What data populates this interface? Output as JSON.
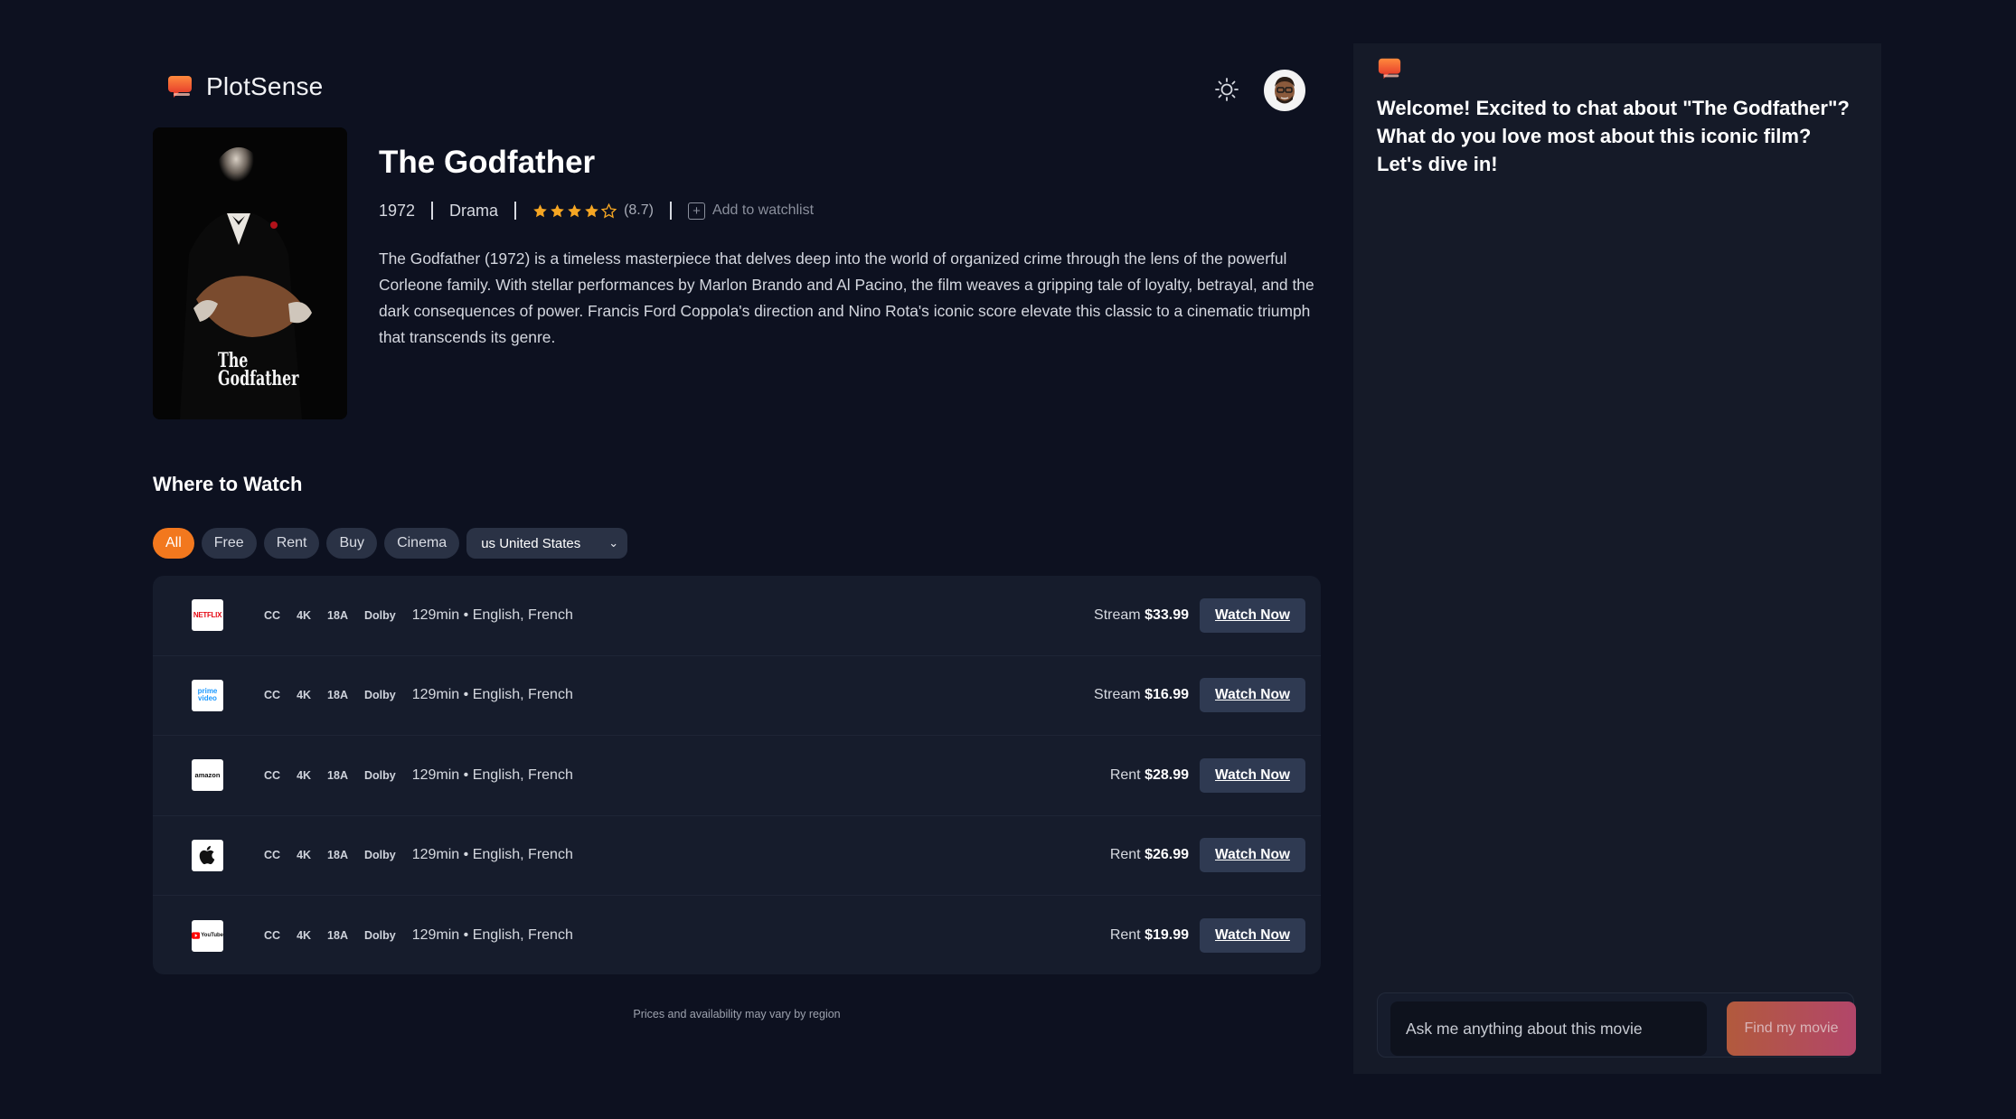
{
  "header": {
    "brand_name": "PlotSense",
    "brand_icon": "chat-bubble-logo-icon",
    "theme_icon": "sun-icon",
    "avatar_icon": "user-avatar"
  },
  "movie": {
    "title": "The Godfather",
    "year": "1972",
    "genre": "Drama",
    "rating_stars": 4.5,
    "rating_text": "(8.7)",
    "watchlist_label": "Add to watchlist",
    "description": "The Godfather (1972) is a timeless masterpiece that delves deep into the world of organized crime through the lens of the powerful Corleone family. With stellar performances by Marlon Brando and Al Pacino, the film weaves a gripping tale of loyalty, betrayal, and the dark consequences of power. Francis Ford Coppola's direction and Nino Rota's iconic score elevate this classic to a cinematic triumph that transcends its genre.",
    "poster_title_line1": "The",
    "poster_title_line2": "Godfather"
  },
  "where_to_watch": {
    "title": "Where to Watch",
    "filters": [
      "All",
      "Free",
      "Rent",
      "Buy",
      "Cinema"
    ],
    "active_filter": "All",
    "region": "us United States",
    "providers": [
      {
        "name": "Netflix",
        "logo_text": "NETFLIX",
        "tags": [
          "CC",
          "4K",
          "18A",
          "Dolby"
        ],
        "info": "129min • English, French",
        "price_type": "Stream",
        "price": "$33.99",
        "button": "Watch Now"
      },
      {
        "name": "Prime Video",
        "logo_text": "prime video",
        "tags": [
          "CC",
          "4K",
          "18A",
          "Dolby"
        ],
        "info": "129min • English, French",
        "price_type": "Stream",
        "price": "$16.99",
        "button": "Watch Now"
      },
      {
        "name": "Amazon",
        "logo_text": "amazon",
        "tags": [
          "CC",
          "4K",
          "18A",
          "Dolby"
        ],
        "info": "129min • English, French",
        "price_type": "Rent",
        "price": "$28.99",
        "button": "Watch Now"
      },
      {
        "name": "Apple TV",
        "logo_text": "",
        "tags": [
          "CC",
          "4K",
          "18A",
          "Dolby"
        ],
        "info": "129min • English, French",
        "price_type": "Rent",
        "price": "$26.99",
        "button": "Watch Now"
      },
      {
        "name": "YouTube",
        "logo_text": "YouTube",
        "tags": [
          "CC",
          "4K",
          "18A",
          "Dolby"
        ],
        "info": "129min • English, French",
        "price_type": "Rent",
        "price": "$19.99",
        "button": "Watch Now"
      }
    ],
    "disclaimer": "Prices and availability may vary by region"
  },
  "chat": {
    "welcome": "Welcome! Excited to chat about \"The Godfather\"? What do you love most about this iconic film? Let's dive in!",
    "input_placeholder": "Ask me anything about this movie",
    "button_label": "Find my movie"
  },
  "colors": {
    "background": "#0d1120",
    "accent": "#f2781e",
    "panel": "#151a28",
    "star": "#f5a623"
  }
}
